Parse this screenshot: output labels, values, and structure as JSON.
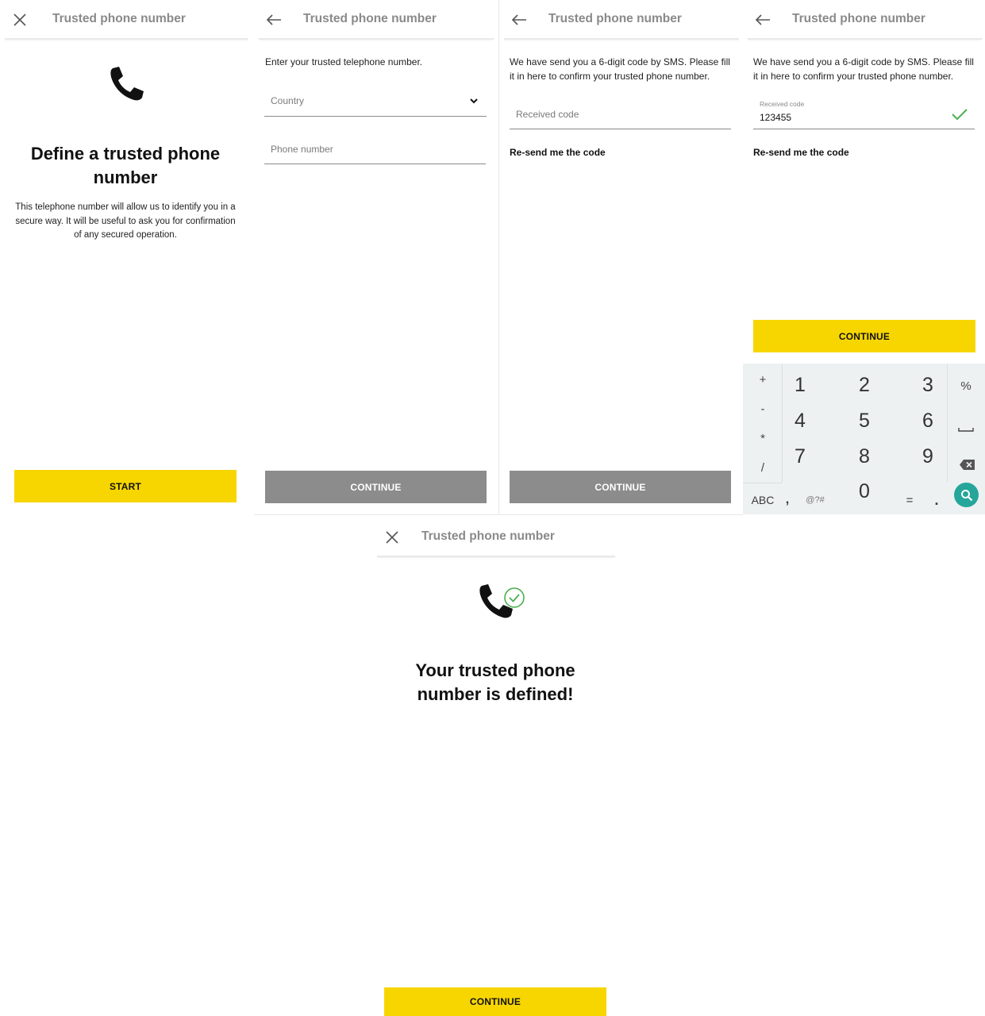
{
  "screens": {
    "intro": {
      "header_title": "Trusted phone number",
      "heading": "Define a trusted phone number",
      "description": "This telephone number will allow us to identify you in a secure way. It will be useful to ask you for confirmation of any secured operation.",
      "start_label": "START"
    },
    "enter_number": {
      "header_title": "Trusted phone number",
      "instruction": "Enter your trusted telephone number.",
      "country_placeholder": "Country",
      "phone_placeholder": "Phone number",
      "continue_label": "CONTINUE"
    },
    "enter_code": {
      "header_title": "Trusted phone number",
      "instruction": "We have send you a 6-digit code by SMS. Please fill it in here to confirm your trusted phone number.",
      "code_placeholder": "Received code",
      "resend_label": "Re-send me the code",
      "continue_label": "CONTINUE"
    },
    "code_filled": {
      "header_title": "Trusted phone number",
      "instruction": "We have send you a 6-digit code by SMS. Please fill it in here to confirm your trusted phone number.",
      "code_label": "Received code",
      "code_value": "123455",
      "resend_label": "Re-send me the code",
      "continue_label": "CONTINUE",
      "keypad": {
        "left_keys": [
          "+",
          "-",
          "*",
          "/"
        ],
        "digits": [
          "1",
          "2",
          "3",
          "4",
          "5",
          "6",
          "7",
          "8",
          "9",
          "0"
        ],
        "right_keys": [
          "%"
        ],
        "bottom_keys": [
          "ABC",
          ",",
          "@?#",
          "=",
          "."
        ]
      }
    },
    "success": {
      "header_title": "Trusted phone number",
      "heading_line1": "Your trusted phone",
      "heading_line2": "number is defined!",
      "continue_label": "CONTINUE"
    }
  },
  "colors": {
    "accent_yellow": "#f7d600",
    "disabled_gray": "#8c8c8c",
    "success_green": "#4caf50",
    "search_teal": "#26a69a"
  }
}
